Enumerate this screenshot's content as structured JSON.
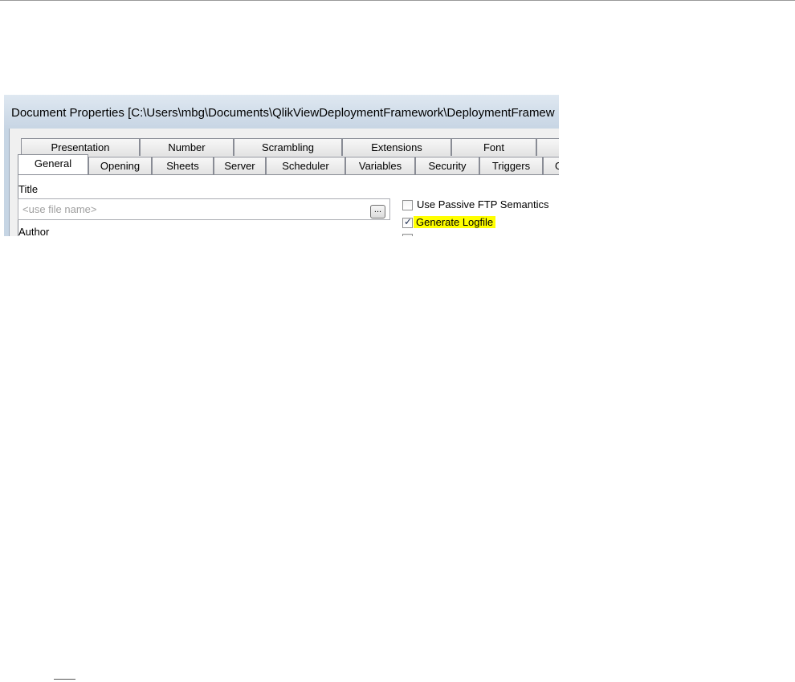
{
  "window": {
    "title": "Document Properties [C:\\Users\\mbg\\Documents\\QlikViewDeploymentFramework\\DeploymentFramew"
  },
  "tabs_back": [
    "Presentation",
    "Number",
    "Scrambling",
    "Extensions",
    "Font",
    ""
  ],
  "tabs_front": [
    "General",
    "Opening",
    "Sheets",
    "Server",
    "Scheduler",
    "Variables",
    "Security",
    "Triggers",
    "G"
  ],
  "active_tab": "General",
  "general": {
    "title_label": "Title",
    "title_placeholder": "<use file name>",
    "browse_label": "...",
    "author_label": "Author"
  },
  "options": {
    "passive_ftp": {
      "label": "Use Passive FTP Semantics",
      "checked": false
    },
    "generate_logfile": {
      "label": "Generate Logfile",
      "checked": true,
      "highlight_color": "#ffff00"
    }
  }
}
